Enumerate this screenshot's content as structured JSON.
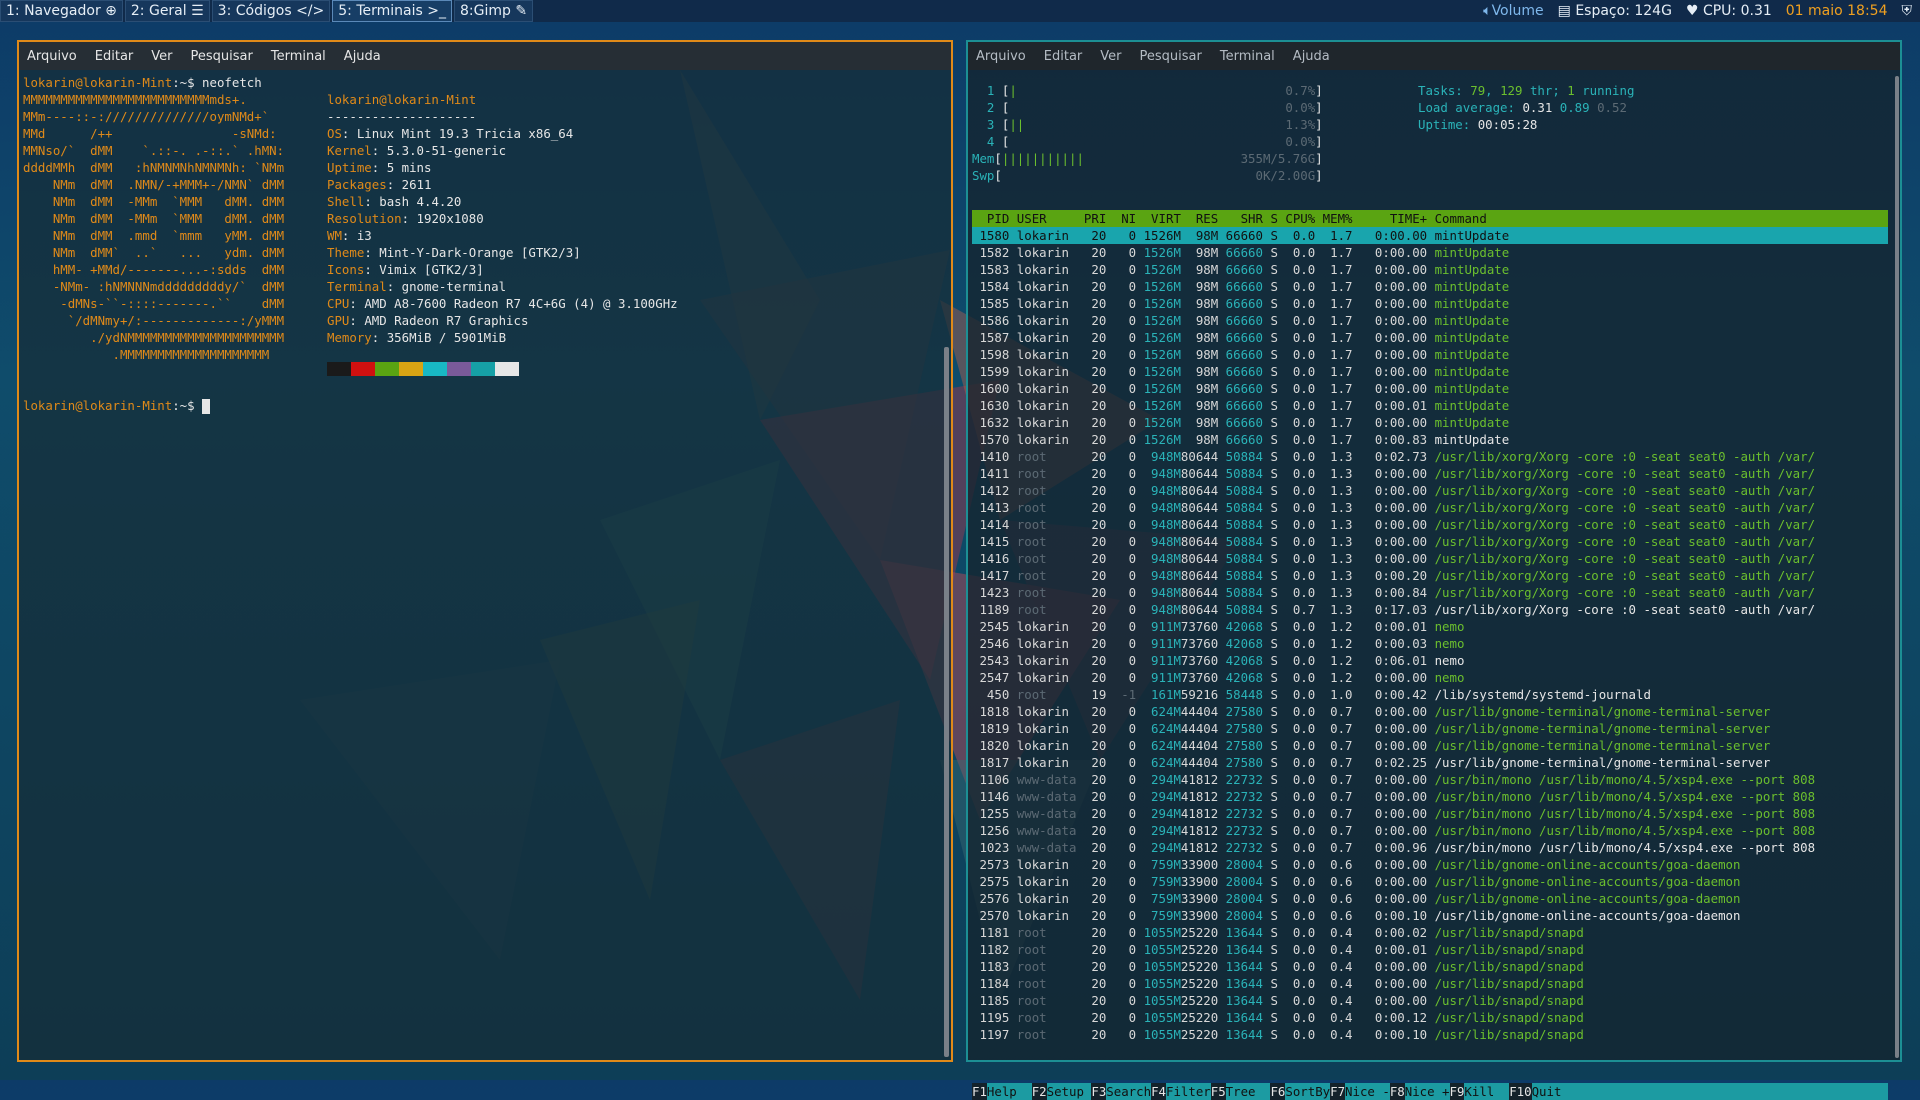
{
  "topbar": {
    "workspaces": [
      {
        "label": "1: Navegador",
        "icon": "globe-icon"
      },
      {
        "label": "2: Geral",
        "icon": "list-icon"
      },
      {
        "label": "3: Códigos",
        "icon": "code-icon"
      },
      {
        "label": "5: Terminais",
        "icon": "terminal-icon"
      },
      {
        "label": "8:Gimp",
        "icon": "brush-icon"
      }
    ],
    "volume": "Volume",
    "disk": "Espaço: 124G",
    "cpu": "CPU: 0.31",
    "datetime": "01 maio 18:54"
  },
  "colors": {
    "orange": "#e08a19",
    "teal": "#1c8f94",
    "green": "#5aa412"
  },
  "menu": [
    "Arquivo",
    "Editar",
    "Ver",
    "Pesquisar",
    "Terminal",
    "Ajuda"
  ],
  "left": {
    "prompt_user": "lokarin@lokarin-Mint",
    "prompt_dir": ":~$ ",
    "command": "neofetch",
    "logo": [
      "MMMMMMMMMMMMMMMMMMMMMMMMMmds+.",
      "MMm----::-://////////////oymNMd+`",
      "MMd      /++                -sNMd:",
      "MMNso/`  dMM    `.::-. .-::.` .hMN:",
      "ddddMMh  dMM   :hNMNMNhNMNMNh: `NMm",
      "    NMm  dMM  .NMN/-+MMM+-/NMN` dMM",
      "    NMm  dMM  -MMm  `MMM   dMM. dMM",
      "    NMm  dMM  -MMm  `MMM   dMM. dMM",
      "    NMm  dMM  .mmd  `mmm   yMM. dMM",
      "    NMm  dMM`  ..`   ...   ydm. dMM",
      "    hMM- +MMd/-------...-:sdds  dMM",
      "    -NMm- :hNMNNNmdddddddddy/`  dMM",
      "     -dMNs-``-::::-------.``    dMM",
      "      `/dMNmy+/:-------------:/yMMM",
      "         ./ydNMMMMMMMMMMMMMMMMMMMMM",
      "            .MMMMMMMMMMMMMMMMMMMM"
    ],
    "info_title": "lokarin@lokarin-Mint",
    "info_rule": "--------------------",
    "info": [
      {
        "k": "OS",
        "v": "Linux Mint 19.3 Tricia x86_64"
      },
      {
        "k": "Kernel",
        "v": "5.3.0-51-generic"
      },
      {
        "k": "Uptime",
        "v": "5 mins"
      },
      {
        "k": "Packages",
        "v": "2611"
      },
      {
        "k": "Shell",
        "v": "bash 4.4.20"
      },
      {
        "k": "Resolution",
        "v": "1920x1080"
      },
      {
        "k": "WM",
        "v": "i3"
      },
      {
        "k": "Theme",
        "v": "Mint-Y-Dark-Orange [GTK2/3]"
      },
      {
        "k": "Icons",
        "v": "Vimix [GTK2/3]"
      },
      {
        "k": "Terminal",
        "v": "gnome-terminal"
      },
      {
        "k": "CPU",
        "v": "AMD A8-7600 Radeon R7 4C+6G (4) @ 3.100GHz"
      },
      {
        "k": "GPU",
        "v": "AMD Radeon R7 Graphics"
      },
      {
        "k": "Memory",
        "v": "356MiB / 5901MiB"
      }
    ],
    "palette": [
      "#1a1a1a",
      "#d01010",
      "#5aa412",
      "#d8a414",
      "#18b8c4",
      "#7a5a9a",
      "#16a0a6",
      "#e6e6e6"
    ]
  },
  "htop": {
    "cpus": [
      {
        "n": "1",
        "bar": "|",
        "pct": "0.7%"
      },
      {
        "n": "2",
        "bar": "",
        "pct": "0.0%"
      },
      {
        "n": "3",
        "bar": "||",
        "pct": "1.3%"
      },
      {
        "n": "4",
        "bar": "",
        "pct": "0.0%"
      }
    ],
    "mem": {
      "label": "Mem",
      "bar": "|||||||||||",
      "val": "355M/5.76G"
    },
    "swp": {
      "label": "Swp",
      "bar": "",
      "val": "0K/2.00G"
    },
    "tasks": {
      "label": "Tasks:",
      "count": "79",
      "thr": "129",
      "thr_label": "thr;",
      "running": "1",
      "running_label": "running"
    },
    "load": {
      "label": "Load average:",
      "a": "0.31",
      "b": "0.89",
      "c": "0.52"
    },
    "uptime": {
      "label": "Uptime:",
      "value": "00:05:28"
    },
    "header": [
      "PID",
      "USER",
      "PRI",
      "NI",
      "VIRT",
      "RES",
      "SHR",
      "S",
      "CPU%",
      "MEM%",
      "TIME+",
      "Command"
    ],
    "rows": [
      [
        "1580",
        "lokarin",
        "20",
        "0",
        "1526M",
        "98M",
        "66660",
        "S",
        "0.0",
        "1.7",
        "0:00.00",
        "mintUpdate",
        "sel"
      ],
      [
        "1582",
        "lokarin",
        "20",
        "0",
        "1526M",
        "98M",
        "66660",
        "S",
        "0.0",
        "1.7",
        "0:00.00",
        "mintUpdate",
        "thr"
      ],
      [
        "1583",
        "lokarin",
        "20",
        "0",
        "1526M",
        "98M",
        "66660",
        "S",
        "0.0",
        "1.7",
        "0:00.00",
        "mintUpdate",
        "thr"
      ],
      [
        "1584",
        "lokarin",
        "20",
        "0",
        "1526M",
        "98M",
        "66660",
        "S",
        "0.0",
        "1.7",
        "0:00.00",
        "mintUpdate",
        "thr"
      ],
      [
        "1585",
        "lokarin",
        "20",
        "0",
        "1526M",
        "98M",
        "66660",
        "S",
        "0.0",
        "1.7",
        "0:00.00",
        "mintUpdate",
        "thr"
      ],
      [
        "1586",
        "lokarin",
        "20",
        "0",
        "1526M",
        "98M",
        "66660",
        "S",
        "0.0",
        "1.7",
        "0:00.00",
        "mintUpdate",
        "thr"
      ],
      [
        "1587",
        "lokarin",
        "20",
        "0",
        "1526M",
        "98M",
        "66660",
        "S",
        "0.0",
        "1.7",
        "0:00.00",
        "mintUpdate",
        "thr"
      ],
      [
        "1598",
        "lokarin",
        "20",
        "0",
        "1526M",
        "98M",
        "66660",
        "S",
        "0.0",
        "1.7",
        "0:00.00",
        "mintUpdate",
        "thr"
      ],
      [
        "1599",
        "lokarin",
        "20",
        "0",
        "1526M",
        "98M",
        "66660",
        "S",
        "0.0",
        "1.7",
        "0:00.00",
        "mintUpdate",
        "thr"
      ],
      [
        "1600",
        "lokarin",
        "20",
        "0",
        "1526M",
        "98M",
        "66660",
        "S",
        "0.0",
        "1.7",
        "0:00.00",
        "mintUpdate",
        "thr"
      ],
      [
        "1630",
        "lokarin",
        "20",
        "0",
        "1526M",
        "98M",
        "66660",
        "S",
        "0.0",
        "1.7",
        "0:00.01",
        "mintUpdate",
        "thr"
      ],
      [
        "1632",
        "lokarin",
        "20",
        "0",
        "1526M",
        "98M",
        "66660",
        "S",
        "0.0",
        "1.7",
        "0:00.00",
        "mintUpdate",
        "thr"
      ],
      [
        "1570",
        "lokarin",
        "20",
        "0",
        "1526M",
        "98M",
        "66660",
        "S",
        "0.0",
        "1.7",
        "0:00.83",
        "mintUpdate",
        "proc"
      ],
      [
        "1410",
        "root",
        "20",
        "0",
        "948M",
        "80644",
        "50884",
        "S",
        "0.0",
        "1.3",
        "0:02.73",
        "/usr/lib/xorg/Xorg -core :0 -seat seat0 -auth /var/",
        "thr"
      ],
      [
        "1411",
        "root",
        "20",
        "0",
        "948M",
        "80644",
        "50884",
        "S",
        "0.0",
        "1.3",
        "0:00.00",
        "/usr/lib/xorg/Xorg -core :0 -seat seat0 -auth /var/",
        "thr"
      ],
      [
        "1412",
        "root",
        "20",
        "0",
        "948M",
        "80644",
        "50884",
        "S",
        "0.0",
        "1.3",
        "0:00.00",
        "/usr/lib/xorg/Xorg -core :0 -seat seat0 -auth /var/",
        "thr"
      ],
      [
        "1413",
        "root",
        "20",
        "0",
        "948M",
        "80644",
        "50884",
        "S",
        "0.0",
        "1.3",
        "0:00.00",
        "/usr/lib/xorg/Xorg -core :0 -seat seat0 -auth /var/",
        "thr"
      ],
      [
        "1414",
        "root",
        "20",
        "0",
        "948M",
        "80644",
        "50884",
        "S",
        "0.0",
        "1.3",
        "0:00.00",
        "/usr/lib/xorg/Xorg -core :0 -seat seat0 -auth /var/",
        "thr"
      ],
      [
        "1415",
        "root",
        "20",
        "0",
        "948M",
        "80644",
        "50884",
        "S",
        "0.0",
        "1.3",
        "0:00.00",
        "/usr/lib/xorg/Xorg -core :0 -seat seat0 -auth /var/",
        "thr"
      ],
      [
        "1416",
        "root",
        "20",
        "0",
        "948M",
        "80644",
        "50884",
        "S",
        "0.0",
        "1.3",
        "0:00.00",
        "/usr/lib/xorg/Xorg -core :0 -seat seat0 -auth /var/",
        "thr"
      ],
      [
        "1417",
        "root",
        "20",
        "0",
        "948M",
        "80644",
        "50884",
        "S",
        "0.0",
        "1.3",
        "0:00.20",
        "/usr/lib/xorg/Xorg -core :0 -seat seat0 -auth /var/",
        "thr"
      ],
      [
        "1423",
        "root",
        "20",
        "0",
        "948M",
        "80644",
        "50884",
        "S",
        "0.0",
        "1.3",
        "0:00.84",
        "/usr/lib/xorg/Xorg -core :0 -seat seat0 -auth /var/",
        "thr"
      ],
      [
        "1189",
        "root",
        "20",
        "0",
        "948M",
        "80644",
        "50884",
        "S",
        "0.7",
        "1.3",
        "0:17.03",
        "/usr/lib/xorg/Xorg -core :0 -seat seat0 -auth /var/",
        "proc"
      ],
      [
        "2545",
        "lokarin",
        "20",
        "0",
        "911M",
        "73760",
        "42068",
        "S",
        "0.0",
        "1.2",
        "0:00.01",
        "nemo",
        "thr"
      ],
      [
        "2546",
        "lokarin",
        "20",
        "0",
        "911M",
        "73760",
        "42068",
        "S",
        "0.0",
        "1.2",
        "0:00.03",
        "nemo",
        "thr"
      ],
      [
        "2543",
        "lokarin",
        "20",
        "0",
        "911M",
        "73760",
        "42068",
        "S",
        "0.0",
        "1.2",
        "0:06.01",
        "nemo",
        "proc"
      ],
      [
        "2547",
        "lokarin",
        "20",
        "0",
        "911M",
        "73760",
        "42068",
        "S",
        "0.0",
        "1.2",
        "0:00.00",
        "nemo",
        "thr"
      ],
      [
        "450",
        "root",
        "19",
        "-1",
        "161M",
        "59216",
        "58448",
        "S",
        "0.0",
        "1.0",
        "0:00.42",
        "/lib/systemd/systemd-journald",
        "proc"
      ],
      [
        "1818",
        "lokarin",
        "20",
        "0",
        "624M",
        "44404",
        "27580",
        "S",
        "0.0",
        "0.7",
        "0:00.00",
        "/usr/lib/gnome-terminal/gnome-terminal-server",
        "thr"
      ],
      [
        "1819",
        "lokarin",
        "20",
        "0",
        "624M",
        "44404",
        "27580",
        "S",
        "0.0",
        "0.7",
        "0:00.00",
        "/usr/lib/gnome-terminal/gnome-terminal-server",
        "thr"
      ],
      [
        "1820",
        "lokarin",
        "20",
        "0",
        "624M",
        "44404",
        "27580",
        "S",
        "0.0",
        "0.7",
        "0:00.00",
        "/usr/lib/gnome-terminal/gnome-terminal-server",
        "thr"
      ],
      [
        "1817",
        "lokarin",
        "20",
        "0",
        "624M",
        "44404",
        "27580",
        "S",
        "0.0",
        "0.7",
        "0:02.25",
        "/usr/lib/gnome-terminal/gnome-terminal-server",
        "proc"
      ],
      [
        "1106",
        "www-data",
        "20",
        "0",
        "294M",
        "41812",
        "22732",
        "S",
        "0.0",
        "0.7",
        "0:00.00",
        "/usr/bin/mono /usr/lib/mono/4.5/xsp4.exe --port 808",
        "thr"
      ],
      [
        "1146",
        "www-data",
        "20",
        "0",
        "294M",
        "41812",
        "22732",
        "S",
        "0.0",
        "0.7",
        "0:00.00",
        "/usr/bin/mono /usr/lib/mono/4.5/xsp4.exe --port 808",
        "thr"
      ],
      [
        "1255",
        "www-data",
        "20",
        "0",
        "294M",
        "41812",
        "22732",
        "S",
        "0.0",
        "0.7",
        "0:00.00",
        "/usr/bin/mono /usr/lib/mono/4.5/xsp4.exe --port 808",
        "thr"
      ],
      [
        "1256",
        "www-data",
        "20",
        "0",
        "294M",
        "41812",
        "22732",
        "S",
        "0.0",
        "0.7",
        "0:00.00",
        "/usr/bin/mono /usr/lib/mono/4.5/xsp4.exe --port 808",
        "thr"
      ],
      [
        "1023",
        "www-data",
        "20",
        "0",
        "294M",
        "41812",
        "22732",
        "S",
        "0.0",
        "0.7",
        "0:00.96",
        "/usr/bin/mono /usr/lib/mono/4.5/xsp4.exe --port 808",
        "proc"
      ],
      [
        "2573",
        "lokarin",
        "20",
        "0",
        "759M",
        "33900",
        "28004",
        "S",
        "0.0",
        "0.6",
        "0:00.00",
        "/usr/lib/gnome-online-accounts/goa-daemon",
        "thr"
      ],
      [
        "2575",
        "lokarin",
        "20",
        "0",
        "759M",
        "33900",
        "28004",
        "S",
        "0.0",
        "0.6",
        "0:00.00",
        "/usr/lib/gnome-online-accounts/goa-daemon",
        "thr"
      ],
      [
        "2576",
        "lokarin",
        "20",
        "0",
        "759M",
        "33900",
        "28004",
        "S",
        "0.0",
        "0.6",
        "0:00.00",
        "/usr/lib/gnome-online-accounts/goa-daemon",
        "thr"
      ],
      [
        "2570",
        "lokarin",
        "20",
        "0",
        "759M",
        "33900",
        "28004",
        "S",
        "0.0",
        "0.6",
        "0:00.10",
        "/usr/lib/gnome-online-accounts/goa-daemon",
        "proc"
      ],
      [
        "1181",
        "root",
        "20",
        "0",
        "1055M",
        "25220",
        "13644",
        "S",
        "0.0",
        "0.4",
        "0:00.02",
        "/usr/lib/snapd/snapd",
        "thr"
      ],
      [
        "1182",
        "root",
        "20",
        "0",
        "1055M",
        "25220",
        "13644",
        "S",
        "0.0",
        "0.4",
        "0:00.01",
        "/usr/lib/snapd/snapd",
        "thr"
      ],
      [
        "1183",
        "root",
        "20",
        "0",
        "1055M",
        "25220",
        "13644",
        "S",
        "0.0",
        "0.4",
        "0:00.00",
        "/usr/lib/snapd/snapd",
        "thr"
      ],
      [
        "1184",
        "root",
        "20",
        "0",
        "1055M",
        "25220",
        "13644",
        "S",
        "0.0",
        "0.4",
        "0:00.00",
        "/usr/lib/snapd/snapd",
        "thr"
      ],
      [
        "1185",
        "root",
        "20",
        "0",
        "1055M",
        "25220",
        "13644",
        "S",
        "0.0",
        "0.4",
        "0:00.00",
        "/usr/lib/snapd/snapd",
        "thr"
      ],
      [
        "1195",
        "root",
        "20",
        "0",
        "1055M",
        "25220",
        "13644",
        "S",
        "0.0",
        "0.4",
        "0:00.12",
        "/usr/lib/snapd/snapd",
        "thr"
      ],
      [
        "1197",
        "root",
        "20",
        "0",
        "1055M",
        "25220",
        "13644",
        "S",
        "0.0",
        "0.4",
        "0:00.10",
        "/usr/lib/snapd/snapd",
        "thr"
      ]
    ],
    "fkeys": [
      {
        "k": "F1",
        "l": "Help  "
      },
      {
        "k": "F2",
        "l": "Setup "
      },
      {
        "k": "F3",
        "l": "Search"
      },
      {
        "k": "F4",
        "l": "Filter"
      },
      {
        "k": "F5",
        "l": "Tree  "
      },
      {
        "k": "F6",
        "l": "SortBy"
      },
      {
        "k": "F7",
        "l": "Nice -"
      },
      {
        "k": "F8",
        "l": "Nice +"
      },
      {
        "k": "F9",
        "l": "Kill  "
      },
      {
        "k": "F10",
        "l": "Quit  "
      }
    ]
  }
}
